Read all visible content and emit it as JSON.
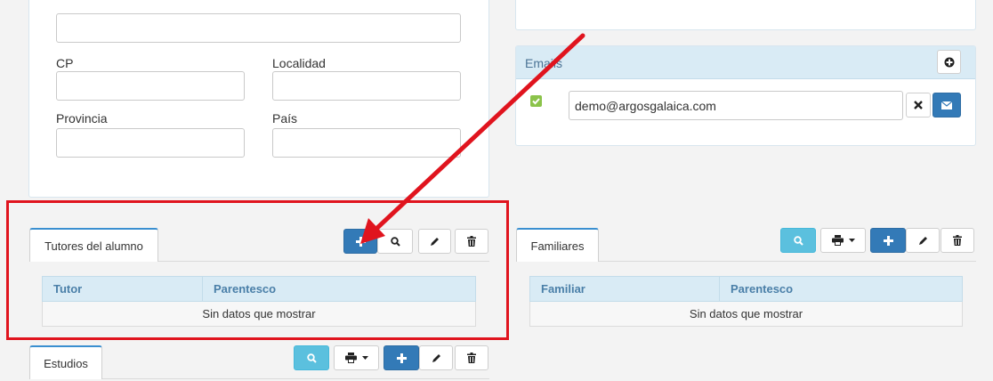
{
  "address": {
    "cp_label": "CP",
    "localidad_label": "Localidad",
    "provincia_label": "Provincia",
    "pais_label": "País"
  },
  "emails": {
    "header": "Emails",
    "items": [
      {
        "value": "demo@argosgalaica.com"
      }
    ]
  },
  "tutores": {
    "tab": "Tutores del alumno",
    "columns": [
      "Tutor",
      "Parentesco"
    ],
    "empty": "Sin datos que mostrar"
  },
  "familiares": {
    "tab": "Familiares",
    "columns": [
      "Familiar",
      "Parentesco"
    ],
    "empty": "Sin datos que mostrar"
  },
  "estudios": {
    "tab": "Estudios"
  },
  "colors": {
    "primary": "#337ab7",
    "info": "#5bc0de",
    "annotation": "#e0141e",
    "header_bg": "#d9ebf5",
    "checkbox": "#8bc34a"
  },
  "icons": [
    "plus-icon",
    "search-icon",
    "pencil-icon",
    "trash-icon",
    "print-icon",
    "caret-down-icon",
    "plus-circle-icon",
    "close-icon",
    "envelope-icon",
    "check-icon"
  ]
}
